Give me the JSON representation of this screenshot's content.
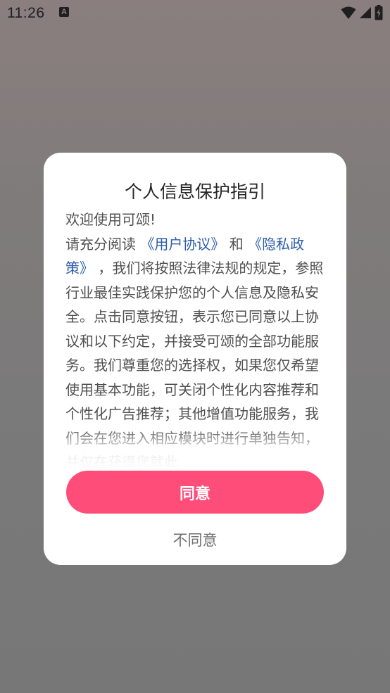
{
  "status_bar": {
    "time": "11:26",
    "notification_icon_letter": "A",
    "icons": [
      "wifi-icon",
      "signal-icon",
      "battery-icon"
    ]
  },
  "dialog": {
    "title": "个人信息保护指引",
    "greeting": "欢迎使用可颂!",
    "intro_prefix": "请充分阅读 ",
    "user_agreement_link": "《用户协议》",
    "connector": " 和 ",
    "privacy_policy_link": "《隐私政策》",
    "intro_suffix": " ，我们将按照法律法规的规定，参照行业最佳实践保护您的个人信息及隐私安全。点击同意按钮，表示您已同意以上协议和以下约定，并接受可颂的全部功能服务。我们尊重您的选择权，如果您仅希望使用基本功能，可关闭个性化内容推荐和个性化广告推荐；其他增值功能服务，我们会在您进入相应模块时进行单独告知，并仅在获得您就此",
    "agree_label": "同意",
    "disagree_label": "不同意"
  },
  "colors": {
    "accent": "#ff4d7a",
    "link": "#2d5ea8"
  }
}
